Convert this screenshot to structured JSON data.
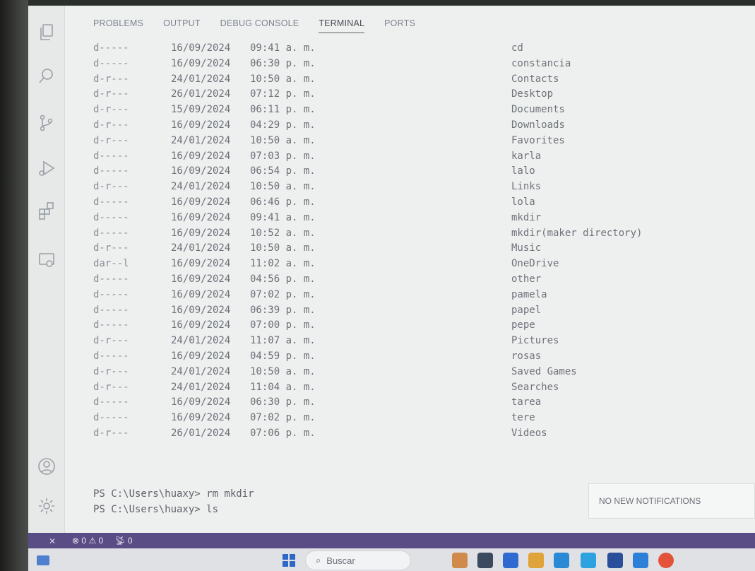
{
  "panel": {
    "tabs": [
      "PROBLEMS",
      "OUTPUT",
      "DEBUG CONSOLE",
      "TERMINAL",
      "PORTS"
    ],
    "active_tab": "TERMINAL"
  },
  "terminal": {
    "rows": [
      {
        "mode": "d-----",
        "date": "16/09/2024",
        "time": "09:41 a. m.",
        "name": "cd"
      },
      {
        "mode": "d-----",
        "date": "16/09/2024",
        "time": "06:30 p. m.",
        "name": "constancia"
      },
      {
        "mode": "d-r---",
        "date": "24/01/2024",
        "time": "10:50 a. m.",
        "name": "Contacts"
      },
      {
        "mode": "d-r---",
        "date": "26/01/2024",
        "time": "07:12 p. m.",
        "name": "Desktop"
      },
      {
        "mode": "d-r---",
        "date": "15/09/2024",
        "time": "06:11 p. m.",
        "name": "Documents"
      },
      {
        "mode": "d-r---",
        "date": "16/09/2024",
        "time": "04:29 p. m.",
        "name": "Downloads"
      },
      {
        "mode": "d-r---",
        "date": "24/01/2024",
        "time": "10:50 a. m.",
        "name": "Favorites"
      },
      {
        "mode": "d-----",
        "date": "16/09/2024",
        "time": "07:03 p. m.",
        "name": "karla"
      },
      {
        "mode": "d-----",
        "date": "16/09/2024",
        "time": "06:54 p. m.",
        "name": "lalo"
      },
      {
        "mode": "d-r---",
        "date": "24/01/2024",
        "time": "10:50 a. m.",
        "name": "Links"
      },
      {
        "mode": "d-----",
        "date": "16/09/2024",
        "time": "06:46 p. m.",
        "name": "lola"
      },
      {
        "mode": "d-----",
        "date": "16/09/2024",
        "time": "09:41 a. m.",
        "name": "mkdir"
      },
      {
        "mode": "d-----",
        "date": "16/09/2024",
        "time": "10:52 a. m.",
        "name": "mkdir(maker directory)"
      },
      {
        "mode": "d-r---",
        "date": "24/01/2024",
        "time": "10:50 a. m.",
        "name": "Music"
      },
      {
        "mode": "dar--l",
        "date": "16/09/2024",
        "time": "11:02 a. m.",
        "name": "OneDrive"
      },
      {
        "mode": "d-----",
        "date": "16/09/2024",
        "time": "04:56 p. m.",
        "name": "other"
      },
      {
        "mode": "d-----",
        "date": "16/09/2024",
        "time": "07:02 p. m.",
        "name": "pamela"
      },
      {
        "mode": "d-----",
        "date": "16/09/2024",
        "time": "06:39 p. m.",
        "name": "papel"
      },
      {
        "mode": "d-----",
        "date": "16/09/2024",
        "time": "07:00 p. m.",
        "name": "pepe"
      },
      {
        "mode": "d-r---",
        "date": "24/01/2024",
        "time": "11:07 a. m.",
        "name": "Pictures"
      },
      {
        "mode": "d-----",
        "date": "16/09/2024",
        "time": "04:59 p. m.",
        "name": "rosas"
      },
      {
        "mode": "d-r---",
        "date": "24/01/2024",
        "time": "10:50 a. m.",
        "name": "Saved Games"
      },
      {
        "mode": "d-r---",
        "date": "24/01/2024",
        "time": "11:04 a. m.",
        "name": "Searches"
      },
      {
        "mode": "d-----",
        "date": "16/09/2024",
        "time": "06:30 p. m.",
        "name": "tarea"
      },
      {
        "mode": "d-----",
        "date": "16/09/2024",
        "time": "07:02 p. m.",
        "name": "tere"
      },
      {
        "mode": "d-r---",
        "date": "26/01/2024",
        "time": "07:06 p. m.",
        "name": "Videos"
      }
    ],
    "prompts": [
      "PS C:\\Users\\huaxy> rm mkdir",
      "PS C:\\Users\\huaxy> ls"
    ]
  },
  "notifications": {
    "text": "NO NEW NOTIFICATIONS"
  },
  "statusbar": {
    "errors": "0",
    "warnings": "0",
    "ports": "0"
  },
  "taskbar": {
    "search_placeholder": "Buscar"
  },
  "colors": {
    "statusbar": "#5a4d86",
    "terminal_text": "#6c7078"
  },
  "icons": [
    "explorer-icon",
    "search-icon",
    "source-control-icon",
    "run-debug-icon",
    "extensions-icon",
    "remote-explorer-icon",
    "account-icon",
    "settings-gear-icon"
  ]
}
